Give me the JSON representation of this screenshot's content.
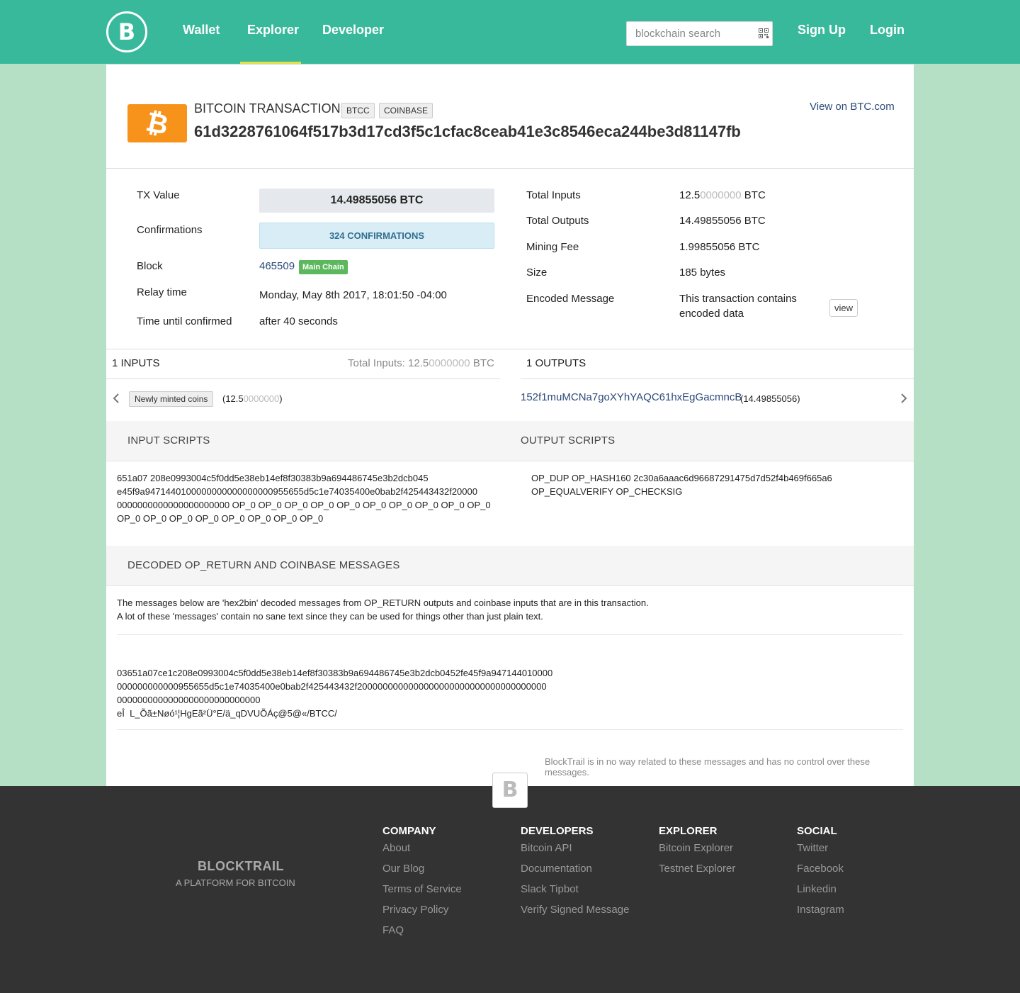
{
  "nav": {
    "logo_letter": "B",
    "links": [
      "Wallet",
      "Explorer",
      "Developer"
    ],
    "search_placeholder": "blockchain search",
    "signup": "Sign Up",
    "login": "Login"
  },
  "header": {
    "logo_glyph": "₿",
    "type": "BITCOIN TRANSACTION",
    "badges": [
      "BTCC",
      "COINBASE"
    ],
    "hash": "61d3228761064f517b3d17cd3f5c1cfac8ceab41e3c8546eca244be3d81147fb",
    "external_link": "View on BTC.com"
  },
  "details": {
    "left": {
      "tx_value_label": "TX Value",
      "tx_value": "14.49855056 BTC",
      "confirmations_label": "Confirmations",
      "confirmations": "324 CONFIRMATIONS",
      "block_label": "Block",
      "block": "465509",
      "block_badge": "Main Chain",
      "relay_label": "Relay time",
      "relay": "Monday, May 8th 2017, 18:01:50 -04:00",
      "until_label": "Time until confirmed",
      "until": "after 40 seconds"
    },
    "right": {
      "total_inputs_label": "Total Inputs",
      "total_inputs_main": "12.5",
      "total_inputs_dim": "0000000",
      "total_inputs_unit": " BTC",
      "total_outputs_label": "Total Outputs",
      "total_outputs": "14.49855056 BTC",
      "fee_label": "Mining Fee",
      "fee": "1.99855056 BTC",
      "size_label": "Size",
      "size": "185 bytes",
      "encoded_label": "Encoded Message",
      "encoded_line1": "This transaction contains",
      "encoded_line2": "encoded data",
      "view_button": "view"
    }
  },
  "io": {
    "inputs_title": "1 INPUTS",
    "inputs_total_prefix": "Total Inputs: 12.5",
    "inputs_total_dim": "0000000",
    "inputs_total_unit": " BTC",
    "outputs_title": "1 OUTPUTS",
    "input_label": "Newly minted coins",
    "input_amount_open": "(12.5",
    "input_amount_dim": "0000000",
    "input_amount_close": ")",
    "output_address": "152f1muMCNa7goXYhYAQC61hxEgGacmncB",
    "output_amount": "(14.49855056)"
  },
  "scripts": {
    "input_title": "INPUT SCRIPTS",
    "output_title": "OUTPUT SCRIPTS",
    "input_lines": [
      "651a07 208e0993004c5f0dd5e38eb14ef8f30383b9a694486745e3b2dcb045",
      "e45f9a9471440100000000000000000955655d5c1e74035400e0bab2f425443432f20000",
      "0000000000000000000000 OP_0 OP_0 OP_0 OP_0 OP_0 OP_0 OP_0 OP_0 OP_0 OP_0",
      "OP_0 OP_0 OP_0 OP_0 OP_0 OP_0 OP_0 OP_0"
    ],
    "output_lines": [
      "OP_DUP OP_HASH160 2c30a6aaac6d96687291475d7d52f4b469f665a6",
      "OP_EQUALVERIFY OP_CHECKSIG"
    ]
  },
  "decoded": {
    "title": "DECODED OP_RETURN AND COINBASE MESSAGES",
    "note_line1": "The messages below are 'hex2bin' decoded messages from OP_RETURN outputs and coinbase inputs that are in this transaction.",
    "note_line2": "A lot of these 'messages' contain no sane text since they can be used for things other than just plain text.",
    "message_lines": [
      "03651a07ce1c208e0993004c5f0dd5e38eb14ef8f30383b9a694486745e3b2dcb0452fe45f9a947144010000",
      "000000000000955655d5c1e74035400e0bab2f425443432f2000000000000000000000000000000000000",
      "0000000000000000000000000000",
      "eÎ  L_Õã±Nøó¹¦HgEã²Ü°E/ä_qDVUÕÁç@5@«/BTCC/"
    ],
    "disclaimer": "BlockTrail is in no way related to these messages and has no control over these messages."
  },
  "footer": {
    "logo_letter": "B",
    "brand": "BLOCKTRAIL",
    "tagline": "A PLATFORM FOR BITCOIN",
    "columns": [
      {
        "title": "COMPANY",
        "links": [
          "About",
          "Our Blog",
          "Terms of Service",
          "Privacy Policy",
          "FAQ"
        ]
      },
      {
        "title": "DEVELOPERS",
        "links": [
          "Bitcoin API",
          "Documentation",
          "Slack Tipbot",
          "Verify Signed Message"
        ]
      },
      {
        "title": "EXPLORER",
        "links": [
          "Bitcoin Explorer",
          "Testnet Explorer"
        ]
      },
      {
        "title": "SOCIAL",
        "links": [
          "Twitter",
          "Facebook",
          "Linkedin",
          "Instagram"
        ]
      }
    ]
  },
  "colors": {
    "nav_bg": "#38b99b",
    "page_bg": "#b5e0c6",
    "bitcoin_orange": "#f7931a",
    "link_blue": "#2c4a7a",
    "footer_bg": "#333333"
  }
}
